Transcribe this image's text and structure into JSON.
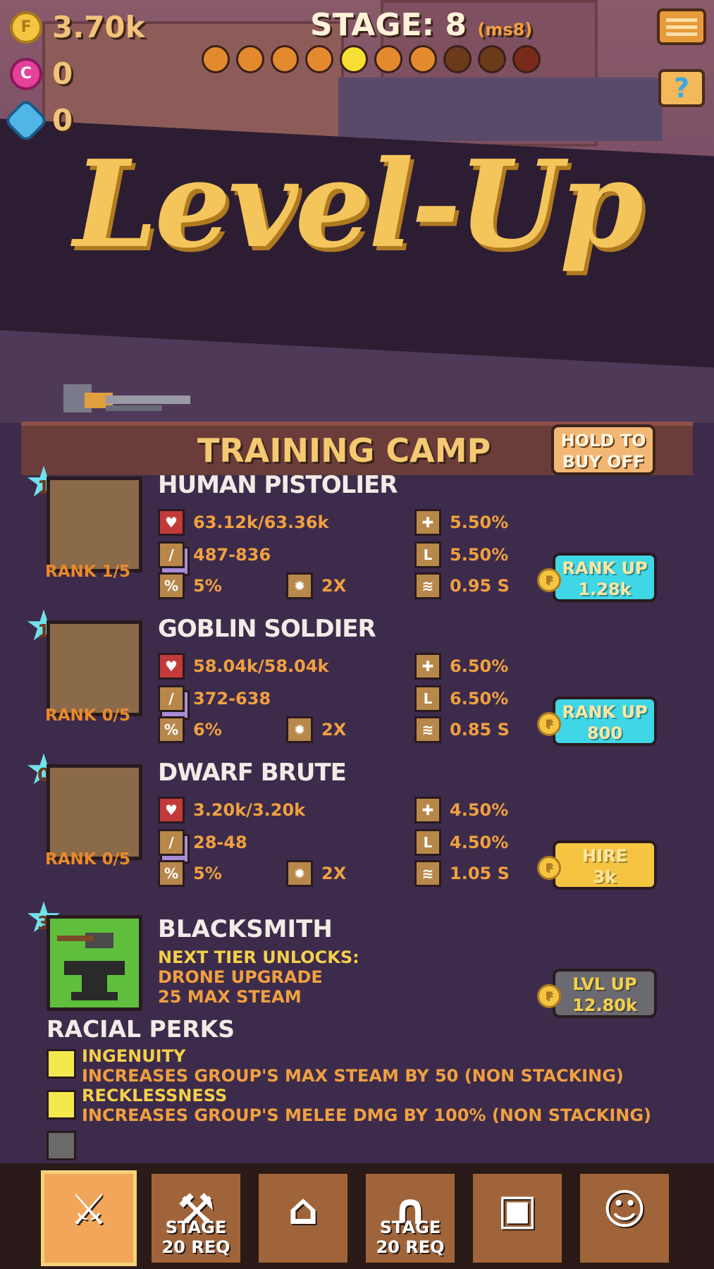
{
  "hud": {
    "gold": "3.70k",
    "gems_pink": "0",
    "gems_blue": "0",
    "stage_label": "STAGE: 8",
    "stage_sub": "(ms8)",
    "stage_dots": [
      "#e38a2e",
      "#e38a2e",
      "#e38a2e",
      "#e38a2e",
      "#f6de33",
      "#e38a2e",
      "#e38a2e",
      "#6a3a1a",
      "#6a3a1a",
      "#7a2a1a"
    ]
  },
  "banner_title": "Level-Up",
  "camp": {
    "title": "TRAINING CAMP",
    "hold_button": "HOLD TO\nBUY OFF"
  },
  "units": [
    {
      "stars": "1",
      "name": "HUMAN PISTOLIER",
      "rank": "RANK 1/5",
      "hp": "63.12k/63.36k",
      "dmg": "487-836",
      "crit": "5%",
      "crit_mult": "2X",
      "armor": "5.50%",
      "dodge": "5.50%",
      "speed": "0.95 S",
      "action": "RANK UP",
      "cost": "1.28k",
      "action_color": "#3fd6e6"
    },
    {
      "stars": "1",
      "name": "GOBLIN SOLDIER",
      "rank": "RANK 0/5",
      "hp": "58.04k/58.04k",
      "dmg": "372-638",
      "crit": "6%",
      "crit_mult": "2X",
      "armor": "6.50%",
      "dodge": "6.50%",
      "speed": "0.85 S",
      "action": "RANK UP",
      "cost": "800",
      "action_color": "#3fd6e6"
    },
    {
      "stars": "0",
      "name": "DWARF BRUTE",
      "rank": "RANK 0/5",
      "hp": "3.20k/3.20k",
      "dmg": "28-48",
      "crit": "5%",
      "crit_mult": "2X",
      "armor": "4.50%",
      "dodge": "4.50%",
      "speed": "1.05 S",
      "action": "HIRE",
      "cost": "3k",
      "action_color": "#f5c542"
    }
  ],
  "blacksmith": {
    "stars": "3",
    "name": "BLACKSMITH",
    "next_tier": "NEXT TIER UNLOCKS:",
    "unlock_1": "DRONE UPGRADE",
    "unlock_2": "25 MAX STEAM",
    "action": "LVL UP",
    "cost": "12.80k"
  },
  "perks": {
    "title": "RACIAL PERKS",
    "items": [
      {
        "name": "INGENUITY",
        "desc": "INCREASES GROUP'S MAX STEAM BY 50 (NON STACKING)"
      },
      {
        "name": "RECKLESSNESS",
        "desc": "INCREASES GROUP'S MELEE DMG BY 100% (NON STACKING)"
      }
    ]
  },
  "tabs": [
    {
      "icon": "sword-hand-icon",
      "label": ""
    },
    {
      "icon": "anvil-icon",
      "label": "STAGE\n20 REQ"
    },
    {
      "icon": "house-icon",
      "label": ""
    },
    {
      "icon": "magnet-icon",
      "label": "STAGE\n20 REQ"
    },
    {
      "icon": "treasure-chest-icon",
      "label": ""
    },
    {
      "icon": "hero-portrait-icon",
      "label": ""
    }
  ]
}
